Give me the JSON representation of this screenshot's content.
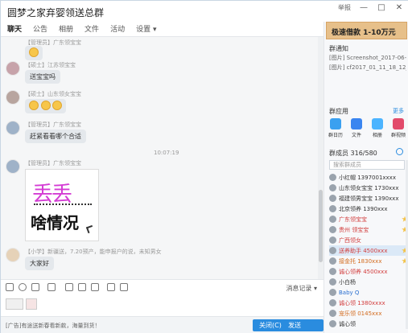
{
  "window": {
    "title": "圆梦之家弃婴领送总群",
    "controls": [
      "举报",
      "—",
      "□",
      "✕"
    ]
  },
  "tabs": [
    {
      "label": "聊天",
      "active": true
    },
    {
      "label": "公告"
    },
    {
      "label": "相册"
    },
    {
      "label": "文件"
    },
    {
      "label": "活动"
    },
    {
      "label": "设置 ▾"
    }
  ],
  "chat": {
    "messages": [
      {
        "meta": "【管理员】广东领宝宝",
        "type": "emoji"
      },
      {
        "meta": "【硕士】江苏领宝宝",
        "text": "送宝宝吗"
      },
      {
        "meta": "【硕士】山东领女宝宝",
        "type": "emojis"
      },
      {
        "meta": "【管理员】广东领宝宝",
        "text": "赶紧看看哪个合适"
      },
      {
        "time": "10:07:19"
      },
      {
        "meta": "【管理员】广东领宝宝",
        "type": "sticker",
        "sticker_line1": "丢丢",
        "sticker_line2": "啥情况"
      },
      {
        "meta": "【小学】新疆送，7.20预产，能申报户的说，未知男女",
        "text": "大家好"
      }
    ]
  },
  "toolbar": {
    "history_label": "消息记录 ▾"
  },
  "input": {
    "hint": "[广告]有途送新春看新款，海量到货！"
  },
  "buttons": {
    "close": "关闭(C)",
    "send": "发送(S)",
    "send_arrow": "▾"
  },
  "right": {
    "ad_text": "极速借款 1-10万元",
    "notice_title": "群通知",
    "notices": [
      "[图片] Screenshot_2017-06-28-13...",
      "[图片] cf2017_01_11_18_12_42.jpg"
    ],
    "apps_title": "群应用",
    "apps_more": "更多",
    "apps": [
      "群日历",
      "文件",
      "相册",
      "群视频"
    ],
    "members_title": "群成员 316/580",
    "search_placeholder": "搜索群成员",
    "members": [
      {
        "name": "小红帽 1397001xxxx",
        "color": ""
      },
      {
        "name": "山东领女宝宝 1730xxx",
        "color": ""
      },
      {
        "name": "福建领男宝宝 1390xxx",
        "color": ""
      },
      {
        "name": "北京领养 1390xxx",
        "color": ""
      },
      {
        "name": "广东领宝宝",
        "color": "red"
      },
      {
        "name": "贵州 领宝宝",
        "color": "red"
      },
      {
        "name": "广西领女",
        "color": "red"
      },
      {
        "name": "送养助手 4500xxx",
        "color": "red",
        "selected": true
      },
      {
        "name": "接金托 1830xxx",
        "color": "orange"
      },
      {
        "name": "诚心领养 4500xxx",
        "color": "red"
      },
      {
        "name": "小白杨",
        "color": ""
      },
      {
        "name": "Baby Q",
        "color": "blue"
      },
      {
        "name": "诚心领 1380xxxx",
        "color": "red"
      },
      {
        "name": "宠乐领 0145xxx",
        "color": "orange"
      },
      {
        "name": "诚心领",
        "color": ""
      }
    ]
  },
  "colors": {
    "accent": "#2a8cdf",
    "chat_bg": "#f5f6f7",
    "bubble": "#e4e8ec",
    "ad": "#e7c08a"
  }
}
